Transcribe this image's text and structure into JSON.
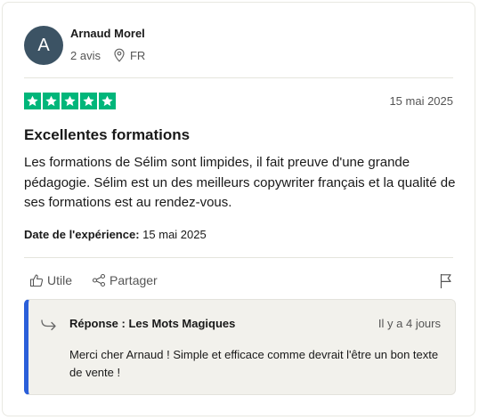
{
  "reviewer": {
    "initial": "A",
    "name": "Arnaud Morel",
    "review_count": "2 avis",
    "country": "FR"
  },
  "review": {
    "rating": 5,
    "date": "15 mai 2025",
    "title": "Excellentes formations",
    "text": "Les formations de Sélim sont limpides, il fait preuve d'une grande pédagogie. Sélim est un des meilleurs copywriter français et la qualité de ses formations est au rendez-vous.",
    "experience_label": "Date de l'expérience:",
    "experience_date": "15 mai 2025"
  },
  "actions": {
    "useful_label": "Utile",
    "share_label": "Partager"
  },
  "reply": {
    "title": "Réponse : Les Mots Magiques",
    "time": "Il y a 4 jours",
    "text": "Merci cher Arnaud ! Simple et efficace comme devrait l'être un bon texte de vente !"
  },
  "colors": {
    "star_green": "#00b67a",
    "avatar_bg": "#3c5364",
    "reply_accent": "#2b5fd9",
    "reply_bg": "#f2f1ec"
  },
  "icons": {
    "location": "location-pin-icon",
    "star": "star-icon",
    "thumbs_up": "thumbs-up-icon",
    "share": "share-icon",
    "flag": "flag-icon",
    "reply": "reply-arrow-icon"
  }
}
